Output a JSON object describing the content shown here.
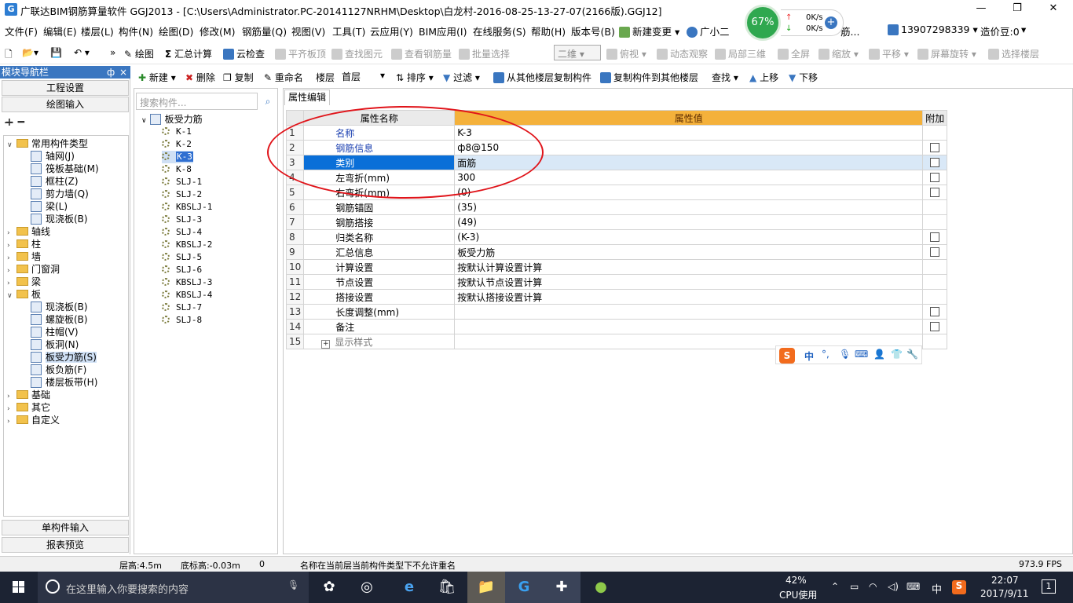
{
  "window": {
    "title": "广联达BIM钢筋算量软件 GGJ2013 - [C:\\Users\\Administrator.PC-20141127NRHM\\Desktop\\白龙村-2016-08-25-13-27-07(2166版).GGJ12]",
    "app_icon": "G"
  },
  "menu": {
    "items": [
      "文件(F)",
      "编辑(E)",
      "楼层(L)",
      "构件(N)",
      "绘图(D)",
      "修改(M)",
      "钢筋量(Q)",
      "视图(V)",
      "工具(T)",
      "云应用(Y)",
      "BIM应用(I)",
      "在线服务(S)",
      "帮助(H)",
      "版本号(B)"
    ],
    "new_change": "新建变更",
    "assistant": "广小二",
    "user": "13907298339",
    "price": "造价豆:0",
    "gauge": "67%",
    "net_up": "0K/s",
    "net_down": "0K/s",
    "overflow": "筋..."
  },
  "toolbar1": {
    "draw": "绘图",
    "sum": "汇总计算",
    "cloud_check": "云检查",
    "flush_top": "平齐板顶",
    "find_element": "查找图元",
    "view_rebar": "查看钢筋量",
    "batch_select": "批量选择",
    "view_mode": "二维",
    "overlook": "俯视",
    "dynamic": "动态观察",
    "local3d": "局部三维",
    "fullscreen": "全屏",
    "zoom": "缩放",
    "pan": "平移",
    "rotate": "屏幕旋转",
    "select_floor": "选择楼层"
  },
  "toolbar2": {
    "new": "新建",
    "delete": "删除",
    "copy": "复制",
    "rename": "重命名",
    "floor_label": "楼层",
    "floor_value": "首层",
    "sort": "排序",
    "filter": "过滤",
    "copy_from": "从其他楼层复制构件",
    "copy_to": "复制构件到其他楼层",
    "find": "查找",
    "move_up": "上移",
    "move_down": "下移"
  },
  "nav": {
    "header": "模块导航栏",
    "pin": "ф",
    "close": "×",
    "project_settings": "工程设置",
    "drawing_input": "绘图输入",
    "single_input": "单构件输入",
    "report_preview": "报表预览",
    "tree": [
      {
        "label": "常用构件类型",
        "level": 0,
        "type": "folder",
        "expanded": true
      },
      {
        "label": "轴网(J)",
        "level": 1,
        "type": "item"
      },
      {
        "label": "筏板基础(M)",
        "level": 1,
        "type": "item"
      },
      {
        "label": "框柱(Z)",
        "level": 1,
        "type": "item"
      },
      {
        "label": "剪力墙(Q)",
        "level": 1,
        "type": "item"
      },
      {
        "label": "梁(L)",
        "level": 1,
        "type": "item"
      },
      {
        "label": "现浇板(B)",
        "level": 1,
        "type": "item"
      },
      {
        "label": "轴线",
        "level": 0,
        "type": "folder"
      },
      {
        "label": "柱",
        "level": 0,
        "type": "folder"
      },
      {
        "label": "墙",
        "level": 0,
        "type": "folder"
      },
      {
        "label": "门窗洞",
        "level": 0,
        "type": "folder"
      },
      {
        "label": "梁",
        "level": 0,
        "type": "folder"
      },
      {
        "label": "板",
        "level": 0,
        "type": "folder",
        "expanded": true
      },
      {
        "label": "现浇板(B)",
        "level": 1,
        "type": "item"
      },
      {
        "label": "螺旋板(B)",
        "level": 1,
        "type": "item"
      },
      {
        "label": "柱帽(V)",
        "level": 1,
        "type": "item"
      },
      {
        "label": "板洞(N)",
        "level": 1,
        "type": "item"
      },
      {
        "label": "板受力筋(S)",
        "level": 1,
        "type": "item",
        "selected": true
      },
      {
        "label": "板负筋(F)",
        "level": 1,
        "type": "item"
      },
      {
        "label": "楼层板带(H)",
        "level": 1,
        "type": "item"
      },
      {
        "label": "基础",
        "level": 0,
        "type": "folder"
      },
      {
        "label": "其它",
        "level": 0,
        "type": "folder"
      },
      {
        "label": "自定义",
        "level": 0,
        "type": "folder"
      }
    ]
  },
  "components": {
    "search_placeholder": "搜索构件...",
    "root": "板受力筋",
    "items": [
      "K-1",
      "K-2",
      "K-3",
      "K-8",
      "SLJ-1",
      "SLJ-2",
      "KBSLJ-1",
      "SLJ-3",
      "SLJ-4",
      "KBSLJ-2",
      "SLJ-5",
      "SLJ-6",
      "KBSLJ-3",
      "KBSLJ-4",
      "SLJ-7",
      "SLJ-8"
    ],
    "selected": "K-3"
  },
  "properties": {
    "tab": "属性编辑",
    "col_name": "属性名称",
    "col_value": "属性值",
    "col_add": "附加",
    "rows": [
      {
        "num": "1",
        "name": "名称",
        "value": "K-3",
        "blue": true,
        "checkbox": false
      },
      {
        "num": "2",
        "name": "钢筋信息",
        "value": "ф8@150",
        "blue": true,
        "checkbox": true
      },
      {
        "num": "3",
        "name": "类别",
        "value": "面筋",
        "blue": false,
        "checkbox": true,
        "selected": true
      },
      {
        "num": "4",
        "name": "左弯折(mm)",
        "value": "300",
        "blue": false,
        "checkbox": true
      },
      {
        "num": "5",
        "name": "右弯折(mm)",
        "value": "(0)",
        "blue": false,
        "checkbox": true
      },
      {
        "num": "6",
        "name": "钢筋锚固",
        "value": "(35)",
        "blue": false,
        "checkbox": false
      },
      {
        "num": "7",
        "name": "钢筋搭接",
        "value": "(49)",
        "blue": false,
        "checkbox": false
      },
      {
        "num": "8",
        "name": "归类名称",
        "value": "(K-3)",
        "blue": false,
        "checkbox": true
      },
      {
        "num": "9",
        "name": "汇总信息",
        "value": "板受力筋",
        "blue": false,
        "checkbox": true
      },
      {
        "num": "10",
        "name": "计算设置",
        "value": "按默认计算设置计算",
        "blue": false,
        "checkbox": false
      },
      {
        "num": "11",
        "name": "节点设置",
        "value": "按默认节点设置计算",
        "blue": false,
        "checkbox": false
      },
      {
        "num": "12",
        "name": "搭接设置",
        "value": "按默认搭接设置计算",
        "blue": false,
        "checkbox": false
      },
      {
        "num": "13",
        "name": "长度调整(mm)",
        "value": "",
        "blue": false,
        "checkbox": true
      },
      {
        "num": "14",
        "name": "备注",
        "value": "",
        "blue": false,
        "checkbox": true
      },
      {
        "num": "15",
        "name": "显示样式",
        "value": "",
        "blue": false,
        "checkbox": false,
        "expandable": true
      }
    ]
  },
  "ime": {
    "logo": "S",
    "mode": "中"
  },
  "status": {
    "floor_height": "层高:4.5m",
    "base_height": "底标高:-0.03m",
    "count": "0",
    "message": "名称在当前层当前构件类型下不允许重名",
    "fps": "973.9 FPS"
  },
  "taskbar": {
    "search_placeholder": "在这里输入你要搜索的内容",
    "cpu_percent": "42%",
    "cpu_label": "CPU使用",
    "ime": "中",
    "time": "22:07",
    "date": "2017/9/11",
    "notifications": "1"
  }
}
